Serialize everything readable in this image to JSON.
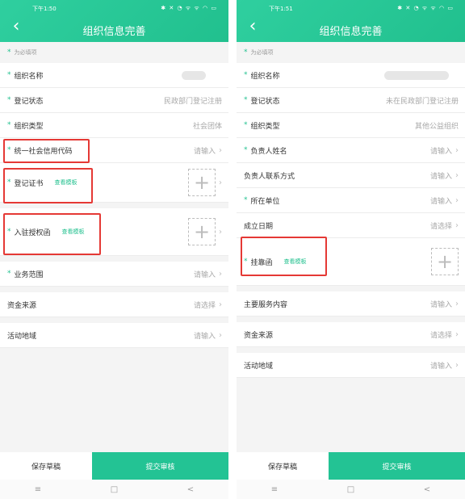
{
  "left": {
    "status": {
      "time": "下午1:50",
      "icons": "✱ ✕ ◔ ᯤ ᯤ ◠ ▭"
    },
    "title": "组织信息完善",
    "required_note": "为必填项",
    "rows": [
      {
        "label": "组织名称",
        "value": ""
      },
      {
        "label": "登记状态",
        "value": "民政部门登记注册"
      },
      {
        "label": "组织类型",
        "value": "社会团体"
      },
      {
        "label": "统一社会信用代码",
        "value": "请输入"
      },
      {
        "label": "登记证书",
        "link": "查看模板"
      },
      {
        "label": "入驻授权函",
        "link": "查看模板"
      },
      {
        "label": "业务范围",
        "value": "请输入"
      },
      {
        "label": "资金来源",
        "value": "请选择"
      },
      {
        "label": "活动地域",
        "value": "请输入"
      }
    ],
    "buttons": {
      "save": "保存草稿",
      "submit": "提交审核"
    },
    "nav": {
      "menu": "≡",
      "home": "□",
      "back": "<"
    }
  },
  "right": {
    "status": {
      "time": "下午1:51",
      "icons": "✱ ✕ ◔ ᯤ ᯤ ◠ ▭"
    },
    "title": "组织信息完善",
    "required_note": "为必填项",
    "rows": [
      {
        "label": "组织名称",
        "value": ""
      },
      {
        "label": "登记状态",
        "value": "未在民政部门登记注册"
      },
      {
        "label": "组织类型",
        "value": "其他公益组织"
      },
      {
        "label": "负责人姓名",
        "value": "请输入"
      },
      {
        "label": "负责人联系方式",
        "value": "请输入"
      },
      {
        "label": "所在单位",
        "value": "请输入"
      },
      {
        "label": "成立日期",
        "value": "请选择"
      },
      {
        "label": "挂靠函",
        "link": "查看模板"
      },
      {
        "label": "主要服务内容",
        "value": "请输入"
      },
      {
        "label": "资金来源",
        "value": "请选择"
      },
      {
        "label": "活动地域",
        "value": "请输入"
      }
    ],
    "buttons": {
      "save": "保存草稿",
      "submit": "提交审核"
    },
    "nav": {
      "menu": "≡",
      "home": "□",
      "back": "<"
    }
  },
  "colors": {
    "accent": "#21c08e",
    "highlight": "#e53935"
  },
  "icons": {
    "back": "chevron-left-icon",
    "chevron": "chevron-right-icon",
    "upload": "plus-icon"
  },
  "glyphs": {
    "back": "‹",
    "chevron": "›",
    "plus": "+",
    "star": "*"
  }
}
